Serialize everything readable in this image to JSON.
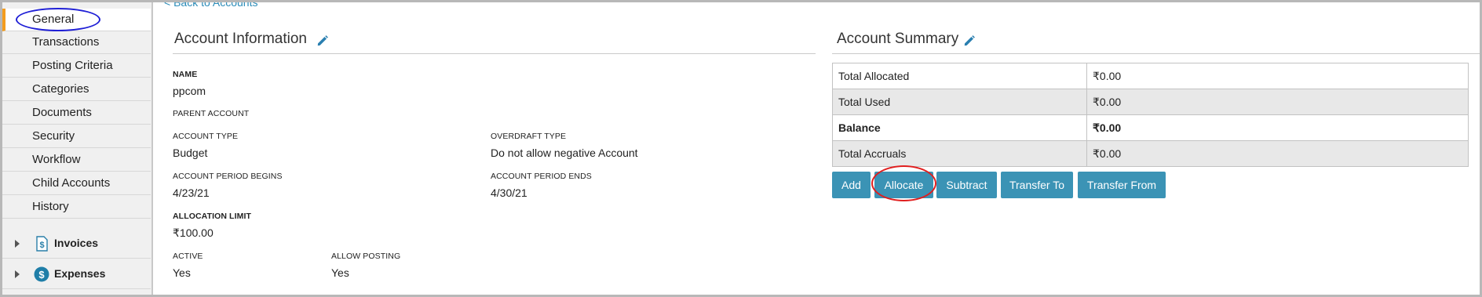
{
  "sidebar": {
    "items": [
      {
        "label": "General"
      },
      {
        "label": "Transactions"
      },
      {
        "label": "Posting Criteria"
      },
      {
        "label": "Categories"
      },
      {
        "label": "Documents"
      },
      {
        "label": "Security"
      },
      {
        "label": "Workflow"
      },
      {
        "label": "Child Accounts"
      },
      {
        "label": "History"
      }
    ],
    "sections": [
      {
        "label": "Invoices",
        "icon": "invoice-icon"
      },
      {
        "label": "Expenses",
        "icon": "dollar-icon"
      }
    ]
  },
  "back_link": "< Back to Accounts",
  "account_info": {
    "title": "Account Information",
    "name_label": "NAME",
    "name_value": "ppcom",
    "parent_label": "PARENT ACCOUNT",
    "type_label": "ACCOUNT TYPE",
    "type_value": "Budget",
    "overdraft_label": "OVERDRAFT TYPE",
    "overdraft_value": "Do not allow negative Account",
    "begins_label": "ACCOUNT PERIOD BEGINS",
    "begins_value": "4/23/21",
    "ends_label": "ACCOUNT PERIOD ENDS",
    "ends_value": "4/30/21",
    "limit_label": "ALLOCATION LIMIT",
    "limit_value": "₹100.00",
    "active_label": "ACTIVE",
    "active_value": "Yes",
    "posting_label": "ALLOW POSTING",
    "posting_value": "Yes"
  },
  "account_summary": {
    "title": "Account Summary",
    "rows": [
      {
        "label": "Total Allocated",
        "value": "₹0.00"
      },
      {
        "label": "Total Used",
        "value": "₹0.00"
      },
      {
        "label": "Balance",
        "value": "₹0.00"
      },
      {
        "label": "Total Accruals",
        "value": "₹0.00"
      }
    ],
    "buttons": [
      "Add",
      "Allocate",
      "Subtract",
      "Transfer To",
      "Transfer From"
    ]
  },
  "colors": {
    "accent": "#3b93b5",
    "active_marker": "#f39c1e",
    "annotation_blue": "#1f1fd6",
    "annotation_red": "#e01e1e"
  }
}
